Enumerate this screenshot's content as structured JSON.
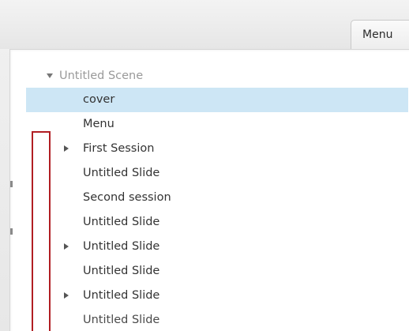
{
  "tabs": {
    "menu_label": "Menu"
  },
  "tree": {
    "scene_label": "Untitled Scene",
    "items": [
      {
        "label": "cover",
        "selected": true,
        "expandable": false
      },
      {
        "label": "Menu",
        "selected": false,
        "expandable": false
      },
      {
        "label": "First Session",
        "selected": false,
        "expandable": true
      },
      {
        "label": "Untitled Slide",
        "selected": false,
        "expandable": false
      },
      {
        "label": "Second session",
        "selected": false,
        "expandable": false
      },
      {
        "label": "Untitled Slide",
        "selected": false,
        "expandable": false
      },
      {
        "label": "Untitled Slide",
        "selected": false,
        "expandable": true
      },
      {
        "label": "Untitled Slide",
        "selected": false,
        "expandable": false
      },
      {
        "label": "Untitled Slide",
        "selected": false,
        "expandable": true
      },
      {
        "label": "Untitled Slide",
        "selected": false,
        "expandable": false
      }
    ]
  },
  "colors": {
    "selection": "#cde6f5",
    "annotation_box": "#b11e23"
  },
  "icons": {
    "scene_toggle": "triangle-down-icon",
    "item_toggle": "triangle-right-icon"
  }
}
